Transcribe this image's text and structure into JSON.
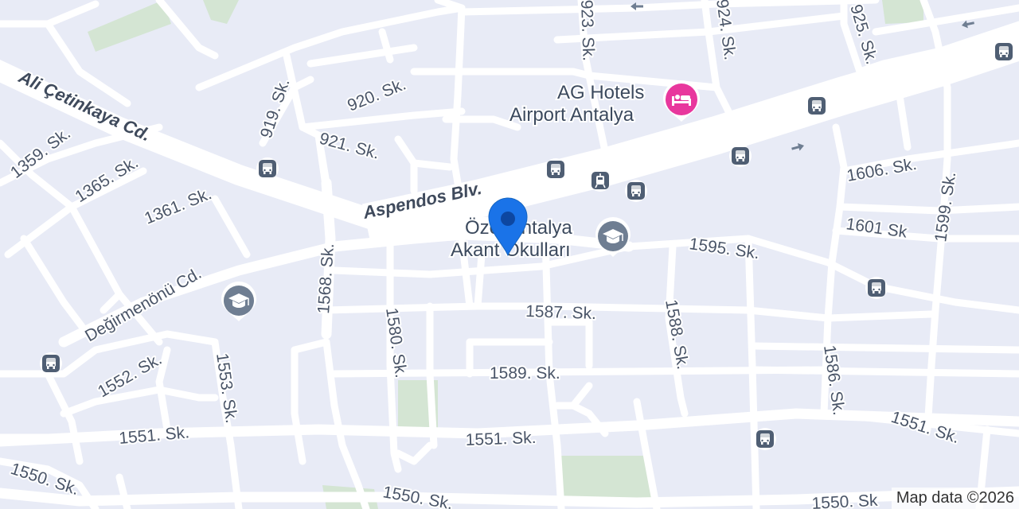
{
  "map": {
    "attribution": "Map data ©2026",
    "colors": {
      "land": "#e8ebf6",
      "road": "#ffffff",
      "park": "#d4e5d3",
      "bus_stop": "#4f5e73",
      "hotel_pin": "#e8379d",
      "school_pin": "#6f7e92",
      "location_pin": "#1a73e8"
    },
    "major_roads": [
      "Ali Çetinkaya Cd.",
      "Aspendos Blv."
    ],
    "streets": [
      "1359. Sk.",
      "1365. Sk.",
      "1361. Sk.",
      "919. Sk.",
      "920. Sk.",
      "921. Sk.",
      "923. Sk.",
      "924. Sk.",
      "925. Sk.",
      "1606. Sk.",
      "1601 Sk",
      "1599. Sk.",
      "1595. Sk.",
      "Değirmenönü Cd.",
      "1568. Sk.",
      "1580. Sk.",
      "1587. Sk.",
      "1588. Sk.",
      "1589. Sk.",
      "1586. Sk.",
      "1552. Sk.",
      "1553. Sk.",
      "1551. Sk.",
      "1551. Sk.",
      "1551. Sk.",
      "1550. Sk.",
      "1550. Sk.",
      "1550. Sk"
    ],
    "pois": {
      "hotel": {
        "line1": "AG Hotels",
        "line2": "Airport Antalya",
        "icon": "hotel-bed-icon"
      },
      "school": {
        "line1": "Özel Antalya",
        "line2": "Akant Okulları",
        "icon": "graduation-cap-icon"
      }
    },
    "icons": {
      "bus": "bus-stop-icon",
      "tram": "tram-stop-icon",
      "school": "school-icon",
      "pin": "location-pin-icon",
      "arrow": "one-way-arrow-icon"
    }
  }
}
